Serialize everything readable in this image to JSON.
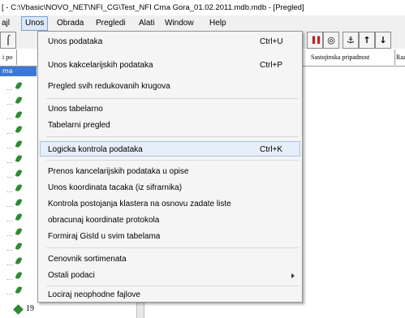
{
  "window": {
    "title": "[ - C:\\Vbasic\\NOVO_NET\\NFI_CG\\Test_NFI Crna Gora_01.02.2011.mdb.mdb - [Pregled]"
  },
  "menubar": {
    "items": [
      "ajl",
      "Unos",
      "Obrada",
      "Pregledi",
      "Alati",
      "Window",
      "Help"
    ]
  },
  "toolbar": {
    "left_glyph": "⌠",
    "chart_glyph": "▐▐",
    "target_glyph": "◎",
    "binoculars_glyph": "⚓",
    "up_glyph": "↑",
    "down_glyph": "↓"
  },
  "tabs": [
    "i po",
    "Sastojinska pripadnost",
    "Raz"
  ],
  "tree": {
    "selected_label": "ma",
    "bottom_label": "19"
  },
  "unos_menu": {
    "items": [
      {
        "label": "Unos podataka",
        "shortcut": "Ctrl+U"
      },
      {
        "label": "Unos kakcelarijskih podataka",
        "shortcut": "Ctrl+P"
      },
      {
        "label": "Pregled svih redukovanih krugova",
        "shortcut": ""
      },
      {
        "label": "Unos tabelarno",
        "shortcut": ""
      },
      {
        "label": "Tabelarni pregled",
        "shortcut": ""
      },
      {
        "label": "Logicka kontrola podataka",
        "shortcut": "Ctrl+K"
      },
      {
        "label": "Prenos kancelarijskih podataka u opise",
        "shortcut": ""
      },
      {
        "label": "Unos koordinata tacaka (iz sifrarnika)",
        "shortcut": ""
      },
      {
        "label": "Kontrola postojanja klastera na osnovu zadate liste",
        "shortcut": ""
      },
      {
        "label": "obracunaj koordinate protokola",
        "shortcut": ""
      },
      {
        "label": "Formiraj GisId u svim tabelama",
        "shortcut": ""
      },
      {
        "label": "Cenovnik sortimenata",
        "shortcut": ""
      },
      {
        "label": "Ostali podaci",
        "shortcut": ""
      },
      {
        "label": "Lociraj neophodne fajlove",
        "shortcut": ""
      }
    ]
  }
}
